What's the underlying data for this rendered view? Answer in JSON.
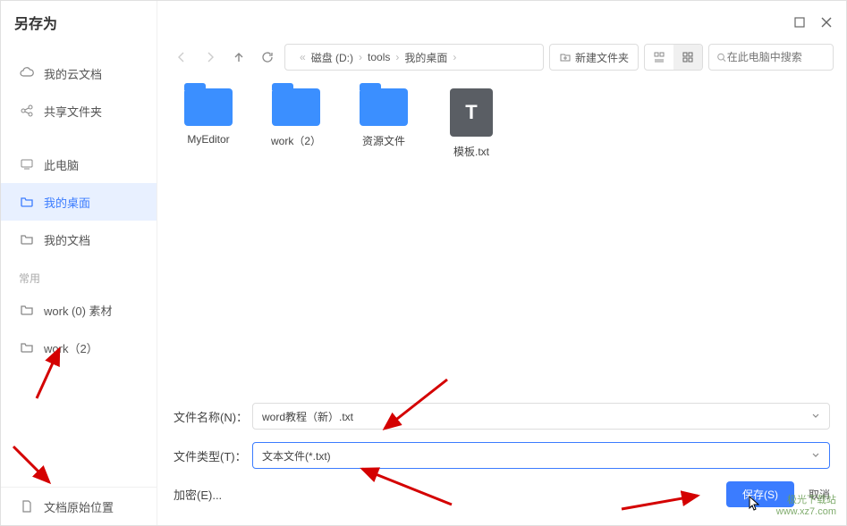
{
  "title": "另存为",
  "sidebar": {
    "items": [
      {
        "label": "我的云文档"
      },
      {
        "label": "共享文件夹"
      },
      {
        "label": "此电脑"
      },
      {
        "label": "我的桌面"
      },
      {
        "label": "我的文档"
      }
    ],
    "recent_label": "常用",
    "recent": [
      {
        "label": "work (0) 素材"
      },
      {
        "label": "work（2）"
      }
    ],
    "bottom": {
      "label": "文档原始位置"
    }
  },
  "toolbar": {
    "breadcrumb": [
      "磁盘 (D:)",
      "tools",
      "我的桌面"
    ],
    "newfolder": "新建文件夹",
    "search_placeholder": "在此电脑中搜索"
  },
  "files": [
    {
      "name": "MyEditor",
      "type": "folder"
    },
    {
      "name": "work（2）",
      "type": "folder"
    },
    {
      "name": "资源文件",
      "type": "folder"
    },
    {
      "name": "模板.txt",
      "type": "txt"
    }
  ],
  "form": {
    "filename_label": "文件名称(N)：",
    "filename_value": "word教程（新）.txt",
    "filetype_label": "文件类型(T)：",
    "filetype_value": "文本文件(*.txt)",
    "encrypt_label": "加密(E)...",
    "save_label": "保存(S)",
    "cancel_label": "取消"
  },
  "watermark": {
    "line1": "极光下载站",
    "line2": "www.xz7.com"
  }
}
